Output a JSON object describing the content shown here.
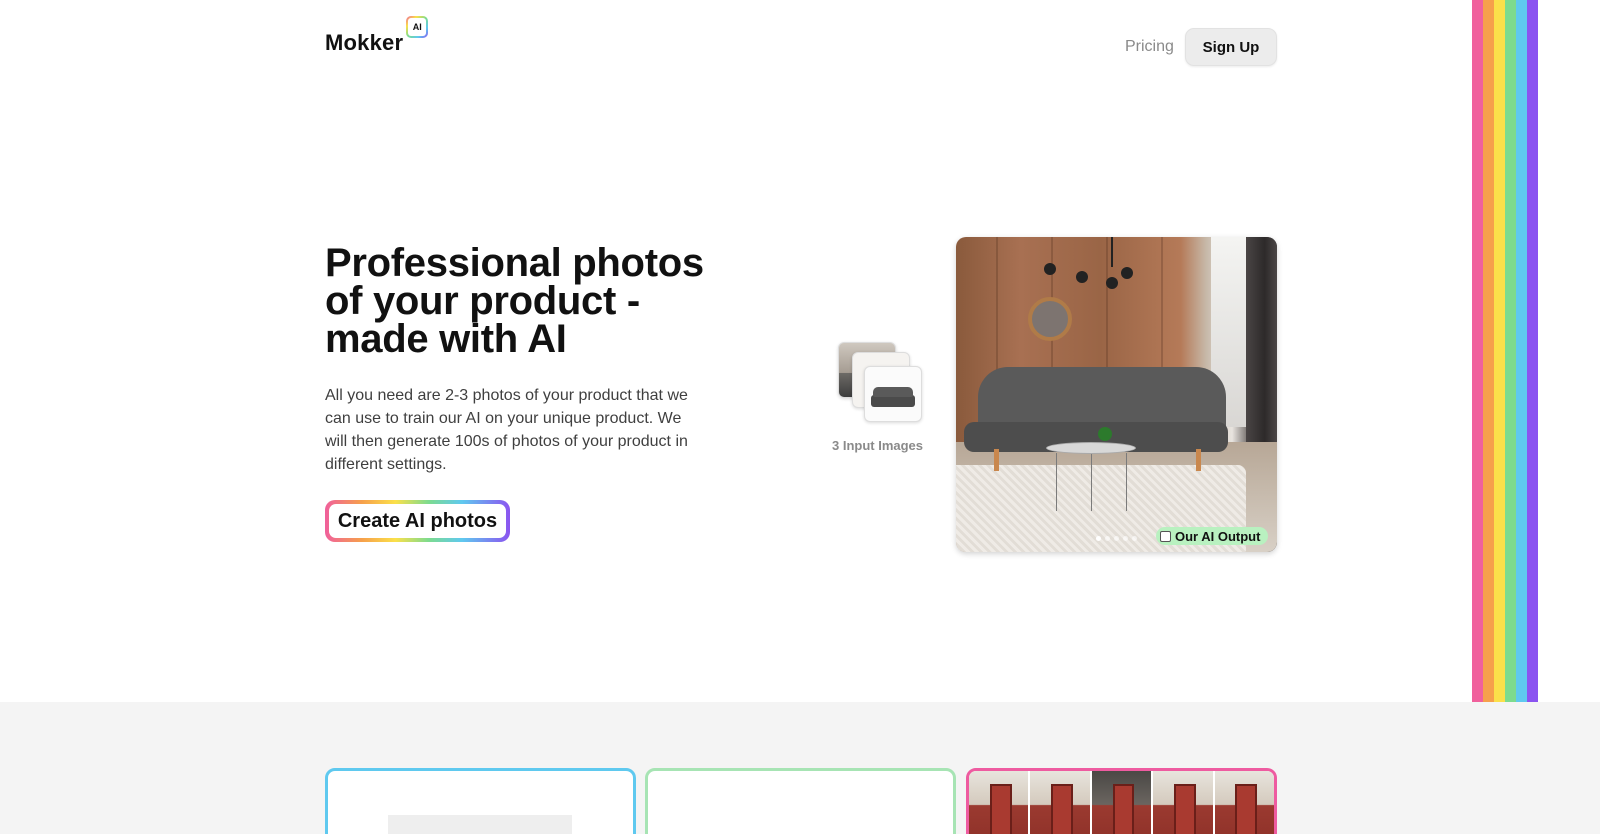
{
  "header": {
    "logo_text": "Mokker",
    "logo_badge": "AI",
    "nav_pricing": "Pricing",
    "nav_signup": "Sign Up"
  },
  "hero": {
    "title_lines": [
      "Professional photos",
      "of your product -",
      "made with AI"
    ],
    "description": "All you need are 2-3 photos of your product that we can use to train our AI on your unique product. We will then generate 100s of photos of your product in different settings.",
    "cta_label": "Create AI photos"
  },
  "showcase": {
    "inputs_label": "3 Input Images",
    "output_badge": "Our AI Output",
    "carousel_dots": 5,
    "carousel_active": 0
  },
  "theme": {
    "rainbow": [
      "#f0609c",
      "#f6a04b",
      "#fbe04a",
      "#7ddb8e",
      "#5fc9ef",
      "#8b54f0"
    ],
    "card_borders": [
      "#5fc9ef",
      "#a7e4b4",
      "#ee5ba0"
    ],
    "highlight": "#f8eca4",
    "badge_green": "#b9f1c0"
  }
}
